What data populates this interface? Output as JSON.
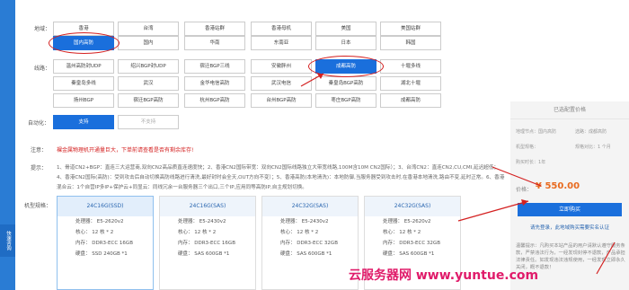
{
  "region": {
    "label": "地域：",
    "row1": [
      "香港",
      "台湾",
      "香港站群",
      "香港母机",
      "美国",
      "美国站群"
    ],
    "row2": [
      "国内高防",
      "国内",
      "华南",
      "东南亚",
      "日本",
      "韩国"
    ],
    "selected": "国内高防"
  },
  "line": {
    "label": "线路：",
    "rows": [
      [
        "温州高防封UDP",
        "绍兴BGP封UDP",
        "宿迁BGP三线",
        "安徽胖州",
        "成都高防",
        "十堰多线"
      ],
      [
        "秦皇岛多线",
        "武汉",
        "金华电信高防",
        "武汉电信",
        "秦皇岛BGP高防",
        "湖北十堰"
      ],
      [
        "扬州BGP",
        "宿迁BGP高防",
        "杭州BGP高防",
        "台州BGP高防",
        "枣庄BGP高防",
        "成都高防"
      ]
    ],
    "selected": "成都高防"
  },
  "auto": {
    "label": "自动化：",
    "yes": "支持",
    "no": "不支持"
  },
  "warning": {
    "label": "注意：",
    "text": "裸金属物理机开通量巨大，下单前请查看是否有剩余库存!"
  },
  "tips": {
    "label": "提示：",
    "text": "1、骨道CN2+BGP：直连三大运营商,双向CN2高品质直连速度快；2、香港CN2国际带宽：双向CN2国际线路独立大带宽线路,100M含10M CN2国际）；3、台湾CN2：直连CN2,CU,CMI,延迟超低；4、香港CN2国际(高防)：受到攻击后自动切换高防线路进行清洗,最好封时会全天,OUT方向不变）；5、香港高防(本地清洗)：本地防御,当服务器受到攻击时,在香港本地清洗,路由不变,延时正常。6、香港混合云：1个自营IP多IP+保护云+同显云：同线冗余一台服务器三个出口,三个IP,应用同等高防IP,自主规划切换。"
  },
  "models": {
    "label": "机型规格：",
    "items": [
      {
        "name": "24C16G(SSD)",
        "cpu_label": "处理器：",
        "cpu": "E5-2620v2",
        "core_label": "核心：",
        "core": "12 核 * 2",
        "mem_label": "内存：",
        "mem": "DDR3-ECC 16GB",
        "disk_label": "硬盘：",
        "disk": "SSD 240GB *1"
      },
      {
        "name": "24C16G(SAS)",
        "cpu_label": "处理器：",
        "cpu": "E5-2430v2",
        "core_label": "核心：",
        "core": "12 核 * 2",
        "mem_label": "内存：",
        "mem": "DDR3-ECC 16GB",
        "disk_label": "硬盘：",
        "disk": "SAS 600GB *1"
      },
      {
        "name": "24C32G(SAS)",
        "cpu_label": "处理器：",
        "cpu": "E5-2430v2",
        "core_label": "核心：",
        "core": "12 核 * 2",
        "mem_label": "内存：",
        "mem": "DDR3-ECC 32GB",
        "disk_label": "硬盘：",
        "disk": "SAS 600GB *1"
      },
      {
        "name": "24C32G(SAS)",
        "cpu_label": "处理器：",
        "cpu": "E5-2620v2",
        "core_label": "核心：",
        "core": "12 核 * 2",
        "mem_label": "内存：",
        "mem": "DDR3-ECC 32GB",
        "disk_label": "硬盘：",
        "disk": "SAS 600GB *1"
      }
    ]
  },
  "side_tab": "快速咨询",
  "summary": {
    "title": "已选配置价格",
    "region_label": "地理节点：",
    "region": "国内高防",
    "line_label": "选路：",
    "line": "成都高防",
    "model_label": "机型规格：",
    "model": "",
    "model2_label": "规格对比：",
    "model2": "1 个月",
    "period_label": "购买时长：",
    "period": "1年",
    "price_label": "价格：",
    "price": "¥ 550.00",
    "buy_label": "立即购买",
    "login_note": "请先登录，此地域购买需要实名认证",
    "notice": "温馨提示：凡购买本站产品的用户请默认遵守服务条款，严禁违法行为，一经发现封停不退款，产品承担法律责任。如发现违法违规使用，一经发现立即永久关闭，概不退款！"
  },
  "watermark": "云服务器网 www.yuntue.com",
  "colors": {
    "accent": "#1a6fdc",
    "warning": "#d42020",
    "price": "#e86a1e",
    "sidebar": "#2a7cd4"
  }
}
